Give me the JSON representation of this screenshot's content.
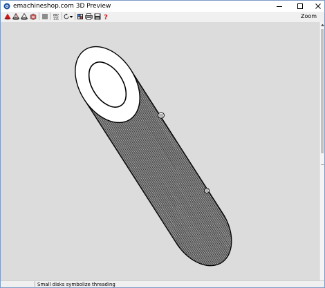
{
  "window": {
    "title": "emachineshop.com 3D Preview",
    "controls": {
      "minimize": "minimize-icon",
      "maximize": "maximize-icon",
      "close": "close-icon"
    }
  },
  "toolbar": {
    "items": [
      {
        "name": "red-cone-icon",
        "color": "#cc1f1f"
      },
      {
        "name": "wireframe-shape-icon"
      },
      {
        "name": "outline-shape-icon"
      },
      {
        "name": "shaded-shape-icon"
      },
      {
        "name": "gray-square-icon"
      },
      {
        "name": "frame-counter-icon"
      },
      {
        "name": "rotate-icon"
      },
      {
        "name": "dropdown-arrow-icon"
      },
      {
        "name": "color-palette-icon"
      },
      {
        "name": "print-icon"
      },
      {
        "name": "save-icon"
      },
      {
        "name": "help-icon",
        "color": "#cc1f1f"
      }
    ],
    "counter_label": "882\n111",
    "zoom_label": "Zoom"
  },
  "viewport": {
    "background": "#dcdcdc",
    "model": "threaded-tube-icon"
  },
  "status": {
    "text": "Small disks symbolize threading"
  }
}
